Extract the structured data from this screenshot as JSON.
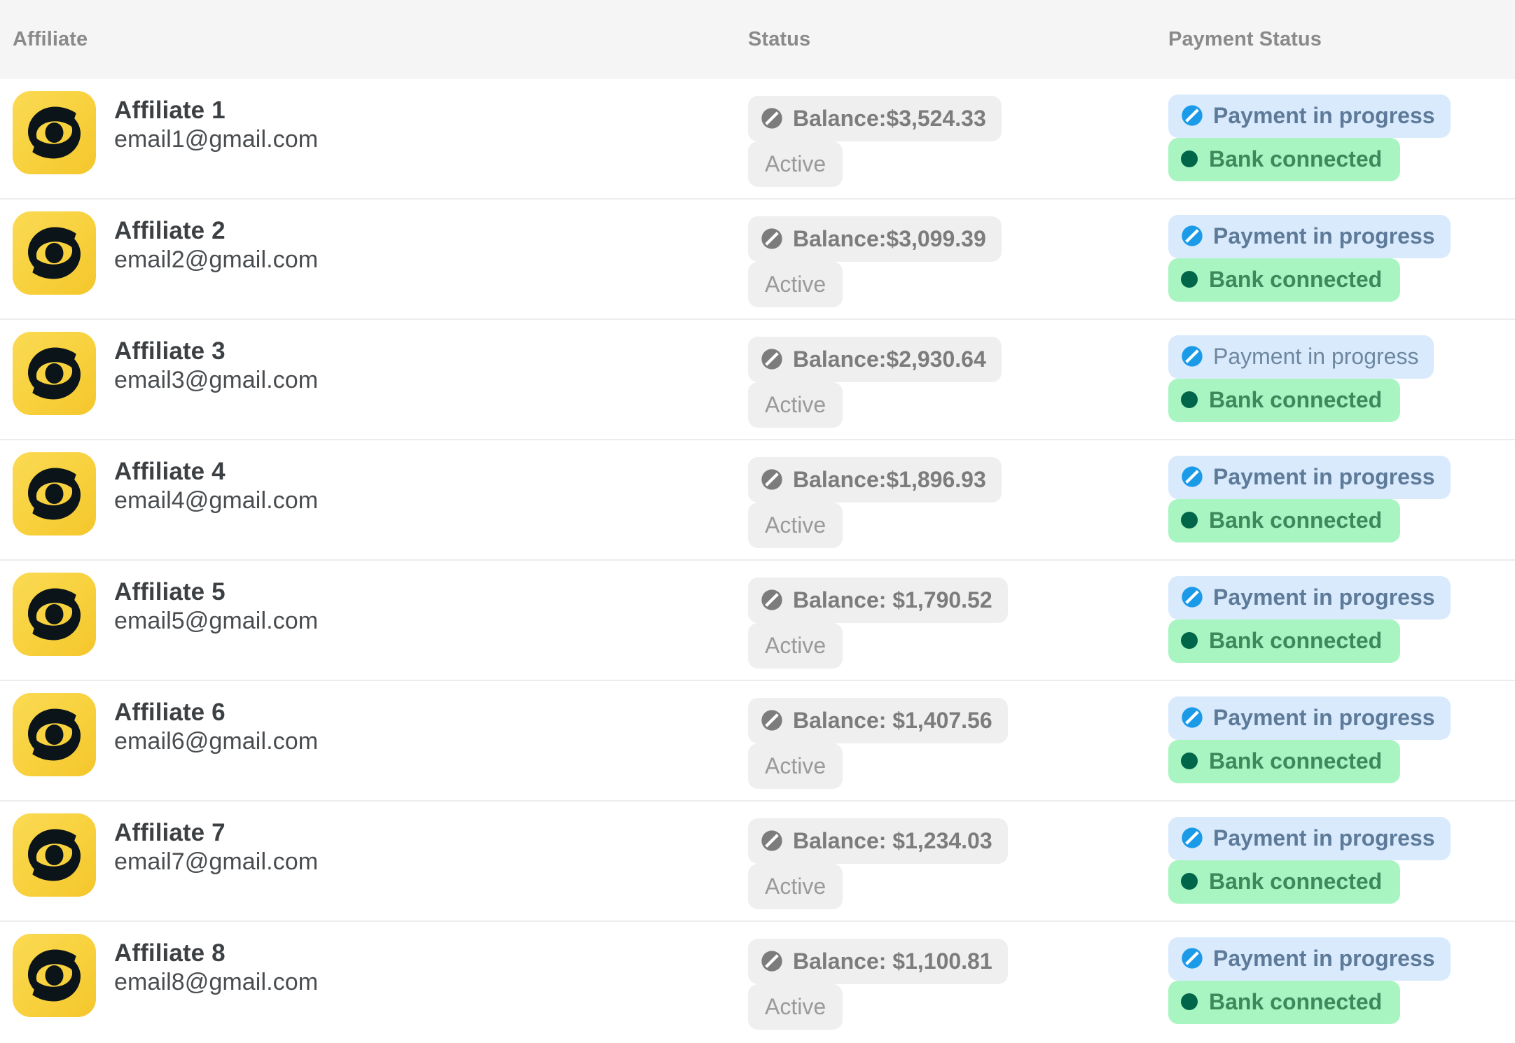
{
  "header": {
    "affiliate": "Affiliate",
    "status": "Status",
    "payment_status": "Payment Status"
  },
  "colors": {
    "avatar_yellow": "#f8d23f",
    "avatar_logo": "#0b1418",
    "header_bg": "#f5f5f5",
    "badge_neutral_bg": "#efefef",
    "badge_payment_bg": "#d9eafd",
    "badge_payment_text": "#5d7a99",
    "badge_payment_icon": "#1b9ae8",
    "badge_bank_bg": "#a9f5c1",
    "badge_bank_text": "#3c8a5b",
    "badge_bank_dot": "#00664a",
    "row_divider": "#ececec"
  },
  "icons": {
    "balance_prohibited": "prohibited-icon",
    "payment_prohibited": "prohibited-icon",
    "bank_dot": "dot-icon",
    "avatar_logo": "affiliate-logo-icon"
  },
  "rows": [
    {
      "name": "Affiliate 1",
      "email": "email1@gmail.com",
      "balance": "Balance:$3,524.33",
      "active": "Active",
      "payment": "Payment in progress",
      "bank": "Bank connected",
      "payment_weight": "bold"
    },
    {
      "name": "Affiliate 2",
      "email": "email2@gmail.com",
      "balance": "Balance:$3,099.39",
      "active": "Active",
      "payment": "Payment in progress",
      "bank": "Bank connected",
      "payment_weight": "bold"
    },
    {
      "name": "Affiliate 3",
      "email": "email3@gmail.com",
      "balance": "Balance:$2,930.64",
      "active": "Active",
      "payment": "Payment in progress",
      "bank": "Bank connected",
      "payment_weight": "light"
    },
    {
      "name": "Affiliate 4",
      "email": "email4@gmail.com",
      "balance": "Balance:$1,896.93",
      "active": "Active",
      "payment": "Payment in progress",
      "bank": "Bank connected",
      "payment_weight": "bold"
    },
    {
      "name": "Affiliate 5",
      "email": "email5@gmail.com",
      "balance": "Balance: $1,790.52",
      "active": "Active",
      "payment": "Payment in progress",
      "bank": "Bank connected",
      "payment_weight": "bold"
    },
    {
      "name": "Affiliate 6",
      "email": "email6@gmail.com",
      "balance": "Balance: $1,407.56",
      "active": "Active",
      "payment": "Payment in progress",
      "bank": "Bank connected",
      "payment_weight": "bold"
    },
    {
      "name": "Affiliate 7",
      "email": "email7@gmail.com",
      "balance": "Balance: $1,234.03",
      "active": "Active",
      "payment": "Payment in progress",
      "bank": "Bank connected",
      "payment_weight": "bold"
    },
    {
      "name": "Affiliate 8",
      "email": "email8@gmail.com",
      "balance": "Balance: $1,100.81",
      "active": "Active",
      "payment": "Payment in progress",
      "bank": "Bank connected",
      "payment_weight": "bold"
    }
  ]
}
